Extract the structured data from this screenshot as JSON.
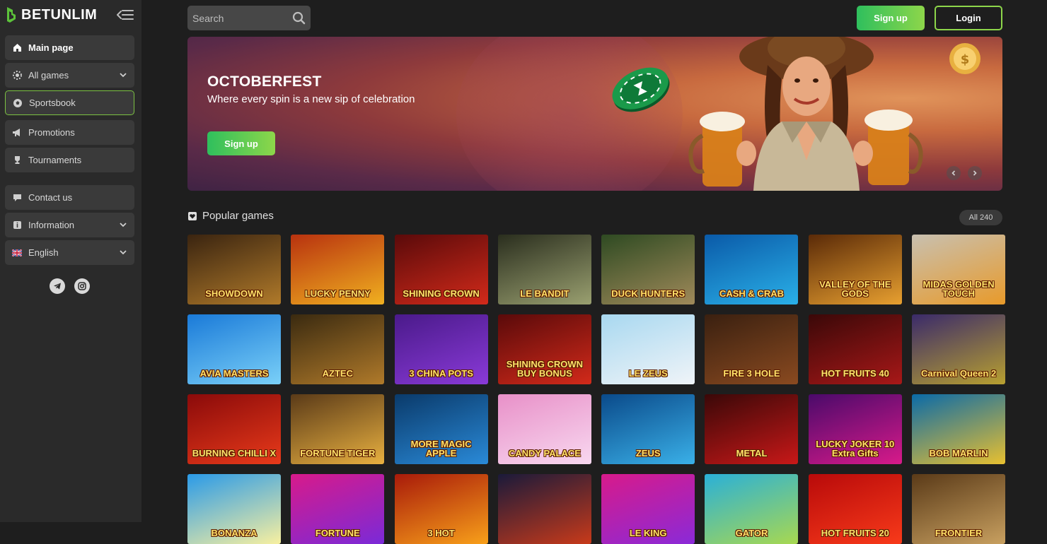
{
  "brand": {
    "name": "BETUNLIM",
    "accent": "#7cc242"
  },
  "sidebar": {
    "items": [
      {
        "label": "Main page",
        "icon": "home-icon"
      },
      {
        "label": "All games",
        "icon": "chip-icon",
        "has_dropdown": true
      },
      {
        "label": "Sportsbook",
        "icon": "ball-icon"
      },
      {
        "label": "Promotions",
        "icon": "megaphone-icon"
      },
      {
        "label": "Tournaments",
        "icon": "trophy-icon"
      },
      {
        "label": "Contact us",
        "icon": "chat-icon"
      },
      {
        "label": "Information",
        "icon": "info-icon",
        "has_dropdown": true
      },
      {
        "label": "English",
        "icon": "uk-flag-icon",
        "has_dropdown": true
      }
    ],
    "social": [
      "telegram-icon",
      "instagram-icon"
    ]
  },
  "header": {
    "search_placeholder": "Search",
    "signup_label": "Sign up",
    "login_label": "Login"
  },
  "banner": {
    "title": "OCTOBERFEST",
    "subtitle": "Where every spin is a new sip of celebration",
    "cta_label": "Sign up"
  },
  "popular": {
    "title": "Popular games",
    "all_label": "All 240",
    "games": [
      {
        "name": "SHOWDOWN",
        "colors": [
          "#3a2410",
          "#b07a2a"
        ]
      },
      {
        "name": "LUCKY PENNY",
        "colors": [
          "#b8320f",
          "#f0b020"
        ]
      },
      {
        "name": "SHINING CROWN",
        "colors": [
          "#5a0a0a",
          "#d22a1a"
        ]
      },
      {
        "name": "LE BANDIT",
        "colors": [
          "#2a2e1e",
          "#9aa070"
        ]
      },
      {
        "name": "DUCK HUNTERS",
        "colors": [
          "#2e4a22",
          "#a08a5a"
        ]
      },
      {
        "name": "CASH & CRAB",
        "colors": [
          "#0a5aa8",
          "#2ab0e8"
        ]
      },
      {
        "name": "VALLEY OF THE GODS",
        "colors": [
          "#5a2a08",
          "#e8a030"
        ]
      },
      {
        "name": "MIDAS GOLDEN TOUCH",
        "colors": [
          "#c8c0b0",
          "#e89a2a"
        ]
      },
      {
        "name": "AVIA MASTERS",
        "colors": [
          "#1a7ad8",
          "#7ad0f8"
        ]
      },
      {
        "name": "AZTEC",
        "colors": [
          "#3a2a10",
          "#b07a2a"
        ]
      },
      {
        "name": "3 CHINA POTS",
        "colors": [
          "#4a1a8a",
          "#8a3ad8"
        ]
      },
      {
        "name": "SHINING CROWN BUY BONUS",
        "colors": [
          "#5a0a0a",
          "#d22a1a"
        ]
      },
      {
        "name": "LE ZEUS",
        "colors": [
          "#a8d8f0",
          "#f0f4f8"
        ]
      },
      {
        "name": "FIRE 3 HOLE",
        "colors": [
          "#3a2010",
          "#8a4a20"
        ]
      },
      {
        "name": "HOT FRUITS 40",
        "colors": [
          "#3a0808",
          "#a81818"
        ]
      },
      {
        "name": "Carnival Queen 2",
        "colors": [
          "#3a2a6a",
          "#b8a030"
        ]
      },
      {
        "name": "BURNING CHILLI X",
        "colors": [
          "#8a0a0a",
          "#e83a1a"
        ]
      },
      {
        "name": "FORTUNE TIGER",
        "colors": [
          "#5a3a18",
          "#e8b040"
        ]
      },
      {
        "name": "MORE MAGIC APPLE",
        "colors": [
          "#0a3a6a",
          "#2a8ad8"
        ]
      },
      {
        "name": "CANDY PALACE",
        "colors": [
          "#e890c8",
          "#f8d8f0"
        ]
      },
      {
        "name": "ZEUS",
        "colors": [
          "#0a4a8a",
          "#3ab0e8"
        ]
      },
      {
        "name": "METAL",
        "colors": [
          "#3a0808",
          "#c81818"
        ]
      },
      {
        "name": "LUCKY JOKER 10 Extra Gifts",
        "colors": [
          "#4a0a6a",
          "#d81a8a"
        ]
      },
      {
        "name": "BOB MARLIN",
        "colors": [
          "#0a6aa8",
          "#e8c030"
        ]
      },
      {
        "name": "BONANZA",
        "colors": [
          "#2a9ae8",
          "#f8f0a0"
        ]
      },
      {
        "name": "FORTUNE",
        "colors": [
          "#d81a8a",
          "#7a2ad8"
        ]
      },
      {
        "name": "3 HOT",
        "colors": [
          "#a81a0a",
          "#f8a01a"
        ]
      },
      {
        "name": "",
        "colors": [
          "#1a1a3a",
          "#c83a1a"
        ]
      },
      {
        "name": "LE KING",
        "colors": [
          "#d81a8a",
          "#8a2ad8"
        ]
      },
      {
        "name": "GATOR",
        "colors": [
          "#2ab0d8",
          "#a8d850"
        ]
      },
      {
        "name": "HOT FRUITS 20",
        "colors": [
          "#b80a0a",
          "#f83a1a"
        ]
      },
      {
        "name": "FRONTIER",
        "colors": [
          "#5a3a18",
          "#c8a060"
        ]
      }
    ]
  }
}
